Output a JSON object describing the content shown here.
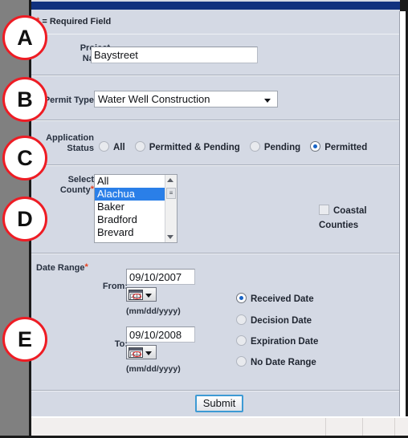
{
  "form": {
    "required_note": "= Required Field",
    "required_marker": "*",
    "project": {
      "label_line1": "Project",
      "label_line2": "Name",
      "value": "Baystreet"
    },
    "permit_type": {
      "label": "Permit Type",
      "value": "Water Well Construction",
      "icon": "chevron-down-icon"
    },
    "application_status": {
      "label_line1": "Application",
      "label_line2": "Status",
      "options": [
        {
          "label": "All",
          "selected": false
        },
        {
          "label": "Permitted & Pending",
          "selected": false
        },
        {
          "label": "Pending",
          "selected": false
        },
        {
          "label": "Permitted",
          "selected": true
        }
      ]
    },
    "county": {
      "label_line1": "Select",
      "label_line2": "County",
      "options": [
        {
          "label": "All",
          "selected": false
        },
        {
          "label": "Alachua",
          "selected": true
        },
        {
          "label": "Baker",
          "selected": false
        },
        {
          "label": "Bradford",
          "selected": false
        },
        {
          "label": "Brevard",
          "selected": false
        }
      ],
      "coastal_checkbox": {
        "label": "Coastal Counties",
        "checked": false
      }
    },
    "date_range": {
      "label": "Date Range",
      "from_label": "From:",
      "from_value": "09/10/2007",
      "from_hint": "(mm/dd/yyyy)",
      "to_label": "To:",
      "to_value": "09/10/2008",
      "to_hint": "(mm/dd/yyyy)",
      "picker_icon": "calendar-icon",
      "date_type_options": [
        {
          "label": "Received Date",
          "selected": true
        },
        {
          "label": "Decision Date",
          "selected": false
        },
        {
          "label": "Expiration Date",
          "selected": false
        },
        {
          "label": "No Date Range",
          "selected": false
        }
      ]
    },
    "submit_label": "Submit"
  },
  "callouts": [
    {
      "letter": "A"
    },
    {
      "letter": "B"
    },
    {
      "letter": "C"
    },
    {
      "letter": "D"
    },
    {
      "letter": "E"
    }
  ],
  "colors": {
    "titlebar": "#10317e",
    "panel_bg": "#d4d9e4",
    "gutter": "#808080",
    "callout_border": "#ee1c24",
    "required_star": "#e8401f",
    "selection": "#2a7fe8",
    "radio_dot": "#1763c6",
    "submit_border": "#3d9ad4"
  }
}
